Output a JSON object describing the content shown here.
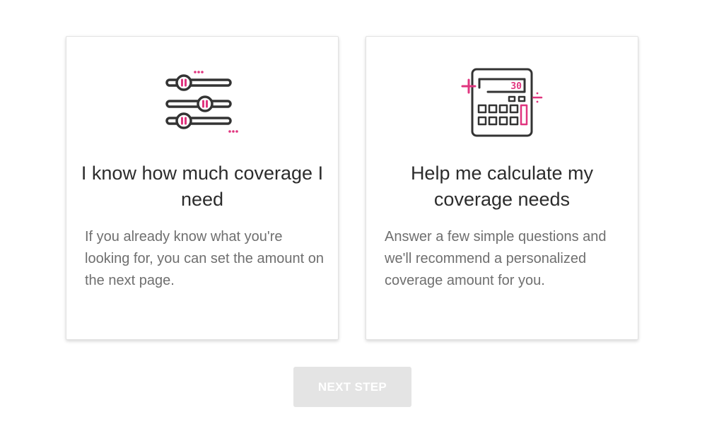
{
  "options": [
    {
      "icon": "sliders-icon",
      "title": "I know how much coverage I need",
      "description": "If you already know what you're looking for, you can set the amount on the next page."
    },
    {
      "icon": "calculator-icon",
      "title": "Help me calculate my coverage needs",
      "description": "Answer a few simple questions and we'll recommend a personalized coverage amount for you.",
      "calculator_display": "30"
    }
  ],
  "next_button": {
    "label": "NEXT STEP"
  },
  "colors": {
    "accent": "#e0357f",
    "icon_stroke": "#333333",
    "button_disabled_bg": "#e4e4e4"
  }
}
